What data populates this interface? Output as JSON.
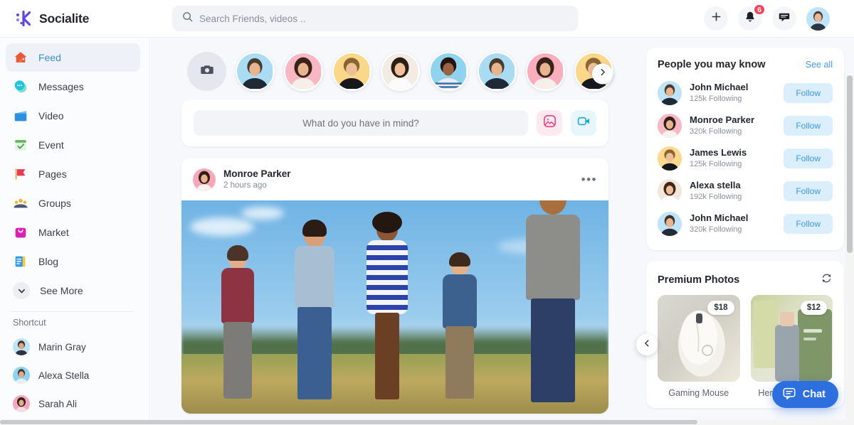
{
  "brand": {
    "name": "Socialite",
    "logo_icon": "socialite-logo-icon",
    "accent": "#5b4ae0"
  },
  "search": {
    "placeholder": "Search Friends, videos ..",
    "value": "",
    "icon": "search-icon"
  },
  "header": {
    "add_icon": "plus-icon",
    "notifications_icon": "bell-icon",
    "notifications_count": "6",
    "messages_icon": "message-bubble-icon",
    "profile_avatar": "user-avatar"
  },
  "sidebar": {
    "items": [
      {
        "label": "Feed",
        "icon": "home-icon",
        "active": true
      },
      {
        "label": "Messages",
        "icon": "chat-icon",
        "active": false
      },
      {
        "label": "Video",
        "icon": "video-clapper-icon",
        "active": false
      },
      {
        "label": "Event",
        "icon": "calendar-check-icon",
        "active": false
      },
      {
        "label": "Pages",
        "icon": "flag-icon",
        "active": false
      },
      {
        "label": "Groups",
        "icon": "people-group-icon",
        "active": false
      },
      {
        "label": "Market",
        "icon": "shopping-bag-icon",
        "active": false
      },
      {
        "label": "Blog",
        "icon": "notes-icon",
        "active": false
      },
      {
        "label": "See More",
        "icon": "chevron-down-icon",
        "active": false
      }
    ],
    "shortcut_title": "Shortcut",
    "shortcuts": [
      {
        "label": "Marin Gray"
      },
      {
        "label": "Alexa Stella"
      },
      {
        "label": "Sarah Ali"
      }
    ]
  },
  "stories": {
    "camera_icon": "camera-icon",
    "next_icon": "chevron-right-icon",
    "items": [
      {
        "bg": "#aadcf4"
      },
      {
        "bg": "#f9b7c4"
      },
      {
        "bg": "#fbd78a"
      },
      {
        "bg": "#f3ece4"
      },
      {
        "bg": "#8fd3ef"
      },
      {
        "bg": "#a9dcf2"
      },
      {
        "bg": "#f8aebd"
      },
      {
        "bg": "#fbd78a"
      }
    ]
  },
  "composer": {
    "placeholder": "What do you have in mind?",
    "value": "",
    "photo_icon": "image-icon",
    "video_icon": "video-camera-icon"
  },
  "post": {
    "author": "Monroe Parker",
    "time": "2 hours ago",
    "more_icon": "ellipsis-icon",
    "more_label": "•••",
    "image_alt": "five friends walking through a field under blue sky"
  },
  "people_panel": {
    "title": "People you may know",
    "see_all": "See all",
    "people": [
      {
        "name": "John Michael",
        "meta": "125k Following",
        "action": "Follow",
        "bg": "#bfe3f7"
      },
      {
        "name": "Monroe Parker",
        "meta": "320k Following",
        "action": "Follow",
        "bg": "#f9b8c6"
      },
      {
        "name": "James Lewis",
        "meta": "125k Following",
        "action": "Follow",
        "bg": "#fbd98d"
      },
      {
        "name": "Alexa stella",
        "meta": "192k Following",
        "action": "Follow",
        "bg": "#f1e7dd"
      },
      {
        "name": "John Michael",
        "meta": "320k Following",
        "action": "Follow",
        "bg": "#bfe3f7"
      }
    ]
  },
  "premium_panel": {
    "title": "Premium Photos",
    "refresh_icon": "refresh-icon",
    "prev_icon": "chevron-left-icon",
    "products": [
      {
        "name": "Gaming Mouse",
        "price": "$18"
      },
      {
        "name": "Herbal Shampoo",
        "price": "$12"
      }
    ]
  },
  "chat_widget": {
    "label": "Chat",
    "icon": "chat-bubble-icon",
    "color": "#2e6fe0"
  }
}
